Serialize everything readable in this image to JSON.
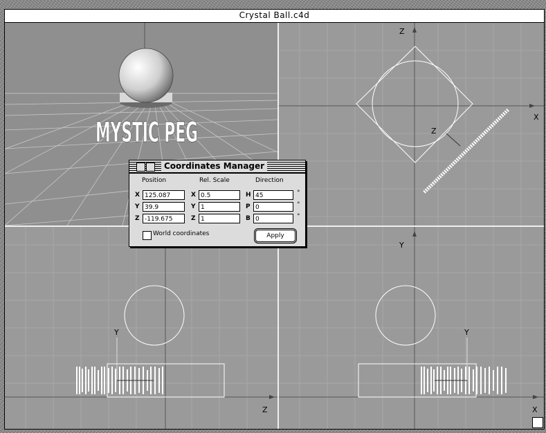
{
  "window": {
    "title": "Crystal Ball.c4d"
  },
  "viewports": {
    "perspective": {
      "logo_text": "MYSTIC PEG"
    },
    "top": {
      "axis_vertical": "Z",
      "axis_horizontal": "X",
      "object_axis": "Z"
    },
    "front": {
      "axis_vertical": "Y",
      "axis_horizontal": "X",
      "object_axis": "Y"
    },
    "side": {
      "axis_vertical": "Y",
      "axis_horizontal": "Z",
      "object_axis": "Y"
    }
  },
  "coordinates_manager": {
    "title": "Coordinates Manager",
    "columns": {
      "position": "Position",
      "scale": "Rel. Scale",
      "direction": "Direction"
    },
    "position": {
      "x_label": "X",
      "x": "125.087",
      "y_label": "Y",
      "y": "39.9",
      "z_label": "Z",
      "z": "-119.675"
    },
    "scale": {
      "x_label": "X",
      "x": "0.5",
      "y_label": "Y",
      "y": "1",
      "z_label": "Z",
      "z": "1"
    },
    "direction": {
      "h_label": "H",
      "h": "45",
      "p_label": "P",
      "p": "0",
      "b_label": "B",
      "b": "0",
      "unit": "°"
    },
    "world_coordinates_label": "World coordinates",
    "world_coordinates_checked": false,
    "apply_label": "Apply"
  }
}
